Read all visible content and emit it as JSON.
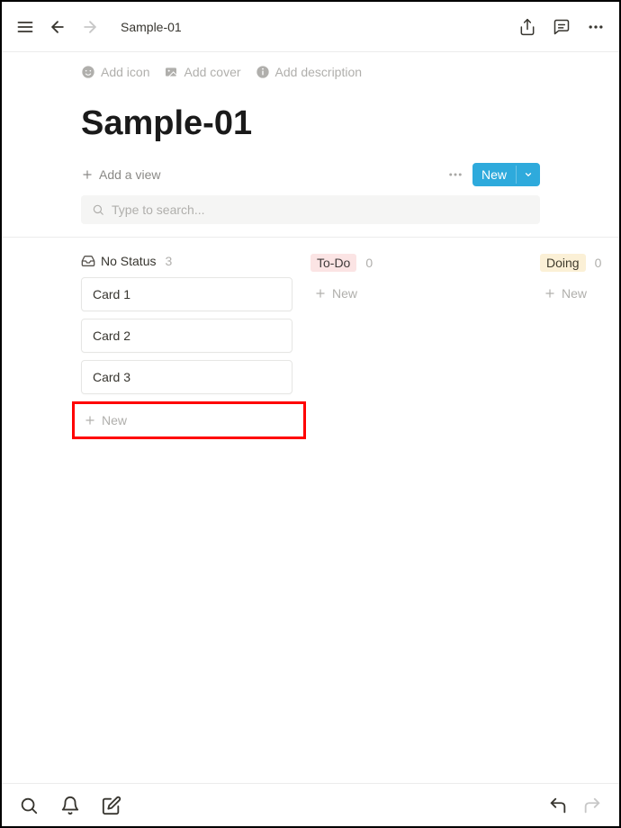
{
  "header": {
    "breadcrumb": "Sample-01"
  },
  "page": {
    "actions": {
      "add_icon": "Add icon",
      "add_cover": "Add cover",
      "add_description": "Add description"
    },
    "title": "Sample-01",
    "add_view": "Add a view",
    "new_button": "New",
    "search_placeholder": "Type to search..."
  },
  "board": {
    "columns": [
      {
        "id": "no-status",
        "label": "No Status",
        "count": "3",
        "type": "plain",
        "cards": [
          "Card 1",
          "Card 2",
          "Card 3"
        ],
        "new_label": "New",
        "highlight_new": true
      },
      {
        "id": "todo",
        "label": "To-Do",
        "count": "0",
        "type": "badge-todo",
        "cards": [],
        "new_label": "New",
        "highlight_new": false
      },
      {
        "id": "doing",
        "label": "Doing",
        "count": "0",
        "type": "badge-doing",
        "cards": [],
        "new_label": "New",
        "highlight_new": false
      }
    ]
  }
}
